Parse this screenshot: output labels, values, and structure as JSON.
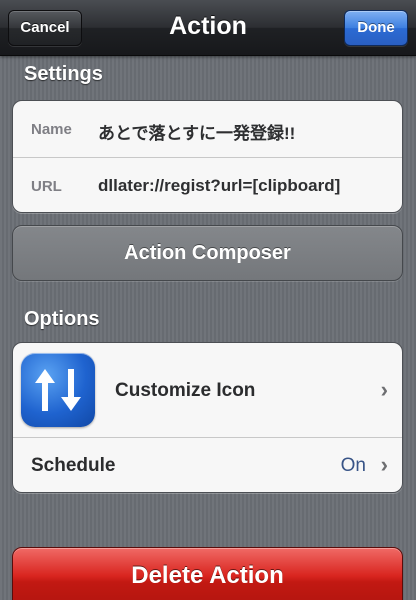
{
  "nav": {
    "title": "Action",
    "cancel_label": "Cancel",
    "done_label": "Done"
  },
  "settings": {
    "header": "Settings",
    "name_label": "Name",
    "name_value": "あとで落とすに一発登録!!",
    "url_label": "URL",
    "url_value": "dllater://regist?url=[clipboard]"
  },
  "composer_label": "Action Composer",
  "options": {
    "header": "Options",
    "customize_icon_label": "Customize Icon",
    "schedule_label": "Schedule",
    "schedule_value": "On"
  },
  "delete_label": "Delete Action",
  "icons": {
    "app_icon": "up-down-arrows-icon",
    "chevron": "chevron-right-icon"
  },
  "colors": {
    "done_button": "#3d7fe0",
    "delete_button": "#c21912",
    "background": "#6b6f75",
    "detail_text": "#385487"
  }
}
